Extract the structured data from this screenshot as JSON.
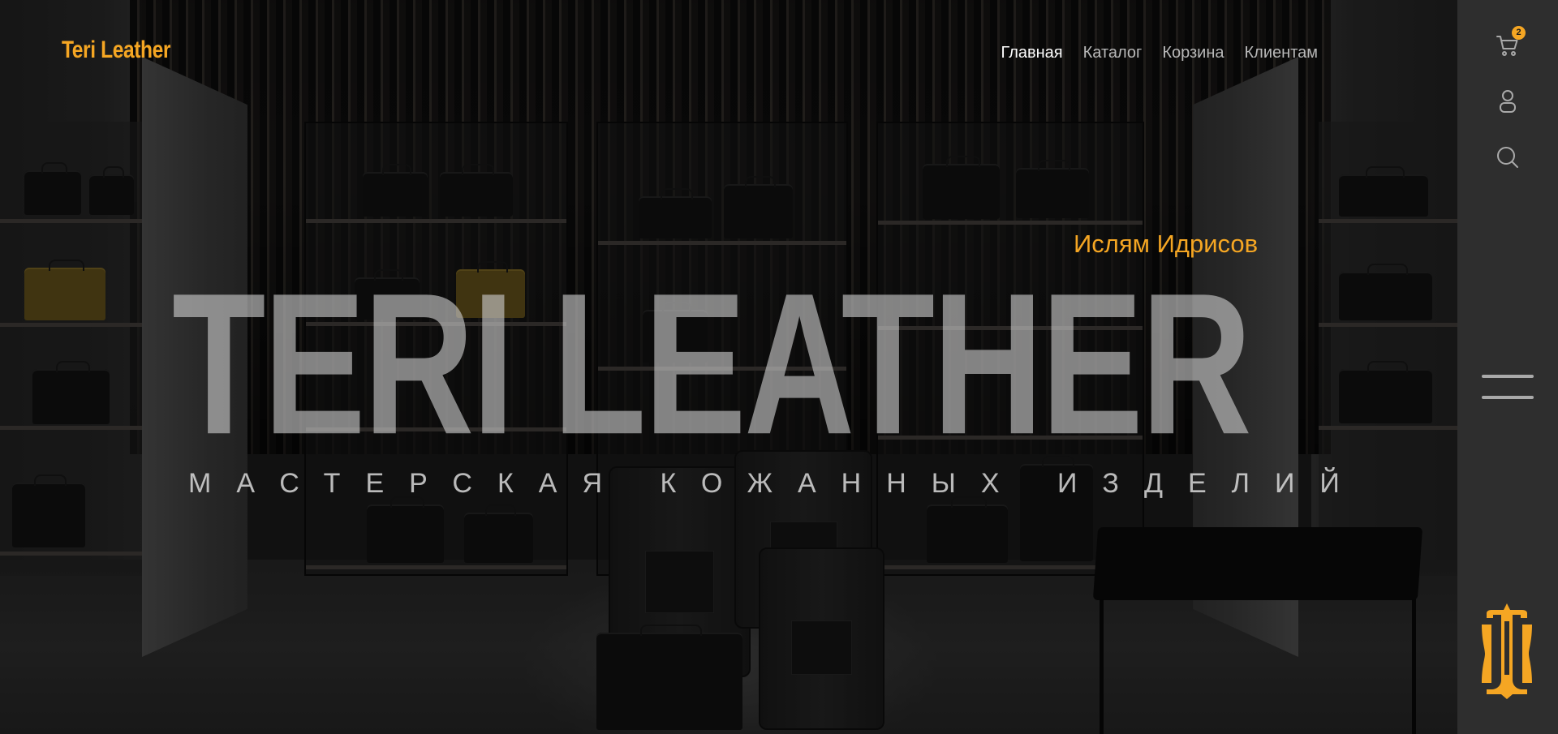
{
  "header": {
    "logo_text": "Teri Leather",
    "nav": [
      {
        "label": "Главная",
        "active": true
      },
      {
        "label": "Каталог",
        "active": false
      },
      {
        "label": "Корзина",
        "active": false
      },
      {
        "label": "Клиентам",
        "active": false
      }
    ]
  },
  "hero": {
    "author": "Ислям Идрисов",
    "title": "TERI LEATHER",
    "subtitle": "МАСТЕРСКАЯ КОЖАННЫХ ИЗДЕЛИЙ"
  },
  "sidebar": {
    "cart_icon": "cart-icon",
    "cart_count": "2",
    "user_icon": "user-icon",
    "search_icon": "search-icon",
    "menu_icon": "hamburger-menu-icon",
    "brand_icon": "brand-monogram-icon"
  },
  "colors": {
    "accent": "#f5a623",
    "sidebar_bg": "#2e2e2e",
    "nav_active": "#ffffff",
    "nav_inactive": "#b8b8b8"
  }
}
